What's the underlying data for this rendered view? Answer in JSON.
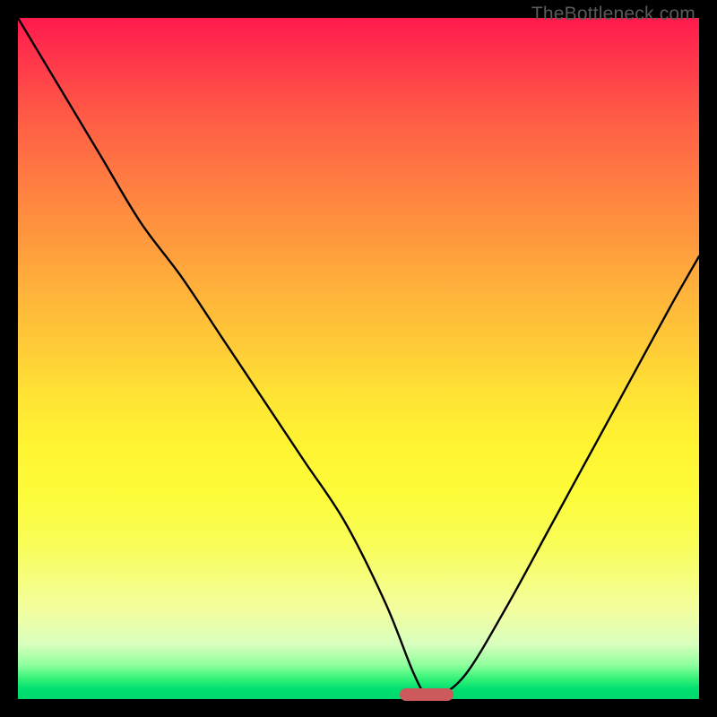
{
  "watermark": "TheBottleneck.com",
  "chart_data": {
    "type": "line",
    "title": "",
    "xlabel": "",
    "ylabel": "",
    "xlim": [
      0,
      100
    ],
    "ylim": [
      0,
      100
    ],
    "series": [
      {
        "name": "curve",
        "x": [
          0,
          6,
          12,
          18,
          24,
          30,
          36,
          42,
          48,
          54,
          58,
          60,
          62,
          66,
          72,
          78,
          84,
          90,
          96,
          100
        ],
        "y": [
          100,
          90,
          80,
          70,
          62,
          53,
          44,
          35,
          26,
          14,
          4,
          0.5,
          0.5,
          4,
          14,
          25,
          36,
          47,
          58,
          65
        ]
      }
    ],
    "marker": {
      "x_start": 56,
      "x_end": 64,
      "y": 0.6
    },
    "gradient_stops": [
      {
        "pos": 0,
        "color": "#ff1a4d"
      },
      {
        "pos": 50,
        "color": "#ffd436"
      },
      {
        "pos": 90,
        "color": "#f3fea0"
      },
      {
        "pos": 100,
        "color": "#00d86e"
      }
    ]
  }
}
